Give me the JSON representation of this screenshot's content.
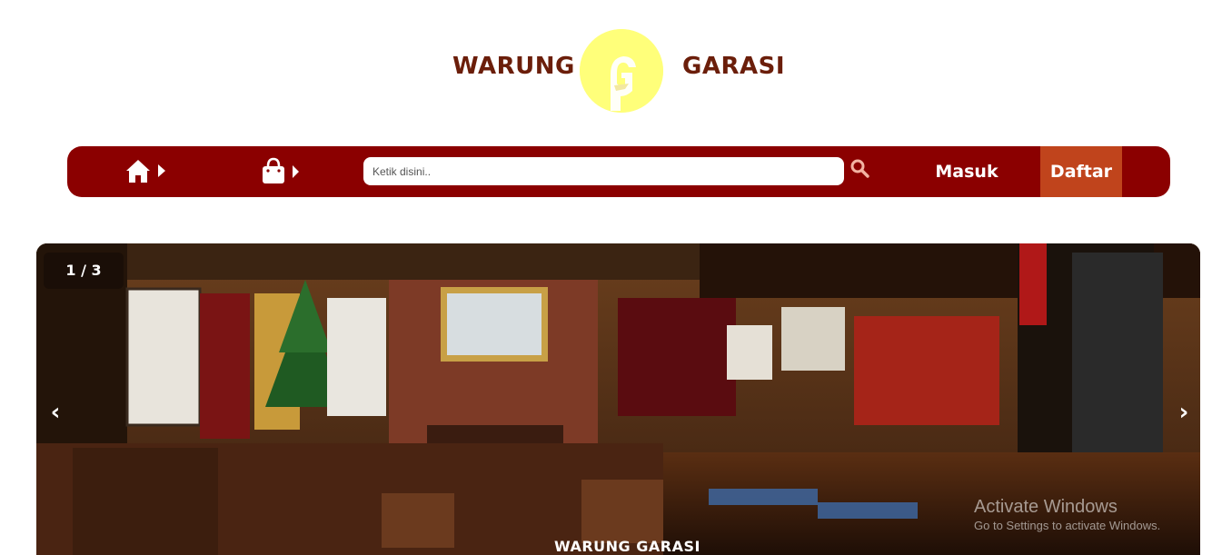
{
  "header": {
    "brand_left": "WARUNG",
    "brand_right": "GARASI",
    "logo_icon": "warung-garasi-logo"
  },
  "nav": {
    "home_icon": "home-icon",
    "cart_icon": "shopping-bag-icon",
    "search": {
      "placeholder": "Ketik disini..",
      "value": "",
      "icon": "search-icon"
    },
    "login_label": "Masuk",
    "register_label": "Daftar"
  },
  "slider": {
    "counter": "1 / 3",
    "prev_label": "‹",
    "next_label": "›",
    "caption": "WARUNG GARASI",
    "image": "restaurant-interior-photo"
  },
  "watermark": {
    "title": "Activate Windows",
    "subtitle": "Go to Settings to activate Windows."
  },
  "colors": {
    "nav_bg": "#8b0000",
    "register_bg": "#c0441c",
    "brand_text": "#6b1e0a",
    "logo_bg": "#ffff7a"
  }
}
